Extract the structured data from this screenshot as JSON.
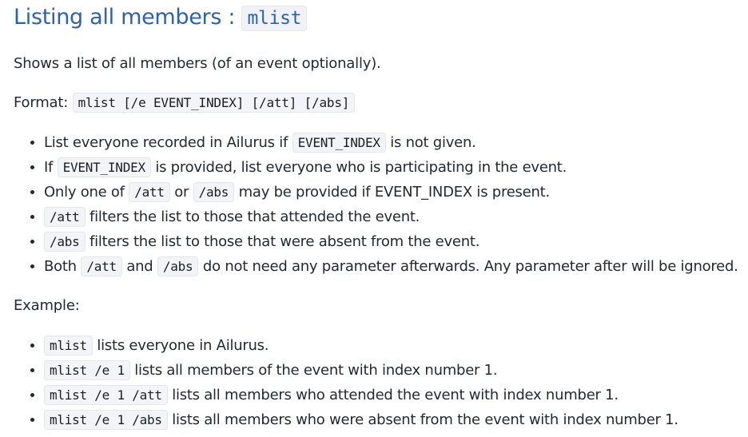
{
  "heading": {
    "text": "Listing all members : ",
    "command": "mlist"
  },
  "description": "Shows a list of all members (of an event optionally).",
  "format": {
    "label": "Format: ",
    "syntax": "mlist [/e EVENT_INDEX] [/att] [/abs]"
  },
  "rules": [
    {
      "pre": "List everyone recorded in Ailurus if ",
      "code": "EVENT_INDEX",
      "mid": " is not given.",
      "code2": "",
      "post": ""
    },
    {
      "pre": "If ",
      "code": "EVENT_INDEX",
      "mid": " is provided, list everyone who is participating in the event.",
      "code2": "",
      "post": ""
    },
    {
      "pre": "Only one of ",
      "code": "/att",
      "mid": " or ",
      "code2": "/abs",
      "post": " may be provided if EVENT_INDEX is present."
    },
    {
      "pre": "",
      "code": "/att",
      "mid": " filters the list to those that attended the event.",
      "code2": "",
      "post": ""
    },
    {
      "pre": "",
      "code": "/abs",
      "mid": " filters the list to those that were absent from the event.",
      "code2": "",
      "post": ""
    },
    {
      "pre": "Both ",
      "code": "/att",
      "mid": " and ",
      "code2": "/abs",
      "post": " do not need any parameter afterwards. Any parameter after will be ignored."
    }
  ],
  "example_label": "Example:",
  "examples": [
    {
      "code": "mlist",
      "text": " lists everyone in Ailurus."
    },
    {
      "code": "mlist /e 1",
      "text": " lists all members of the event with index number 1."
    },
    {
      "code": "mlist /e 1 /att",
      "text": " lists all members who attended the event with index number 1."
    },
    {
      "code": "mlist /e 1 /abs",
      "text": " lists all members who were absent from the event with index number 1."
    }
  ],
  "colors": {
    "heading": "#2d63a8",
    "text": "#24292e",
    "code_bg": "#f3f4f8"
  }
}
